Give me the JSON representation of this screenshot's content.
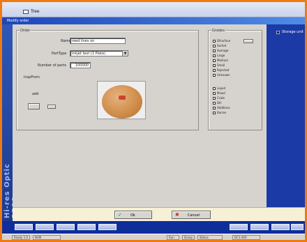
{
  "top": {
    "tab_label": "Tree"
  },
  "dialog": {
    "title": "Modify order"
  },
  "side": {
    "checkbox_label": "Storage unit"
  },
  "form": {
    "group_title": "Order",
    "name_label": "Name",
    "name_value": "reed lines on",
    "parttype_label": "PartType",
    "parttype_value": "inkjet text (1 Plate)",
    "number_label": "Number of parts",
    "number_value": "100000",
    "inspection_label": "InspFrom",
    "add_label": "add",
    "photo_label": "Ed"
  },
  "grades": {
    "group_title": "Grades",
    "set1": [
      "Dfsurface",
      "Sorted",
      "Average",
      "Large",
      "Medium",
      "Small",
      "Rejected",
      "Unknown"
    ],
    "set2": [
      "Liquid",
      "Mixed",
      "Crate",
      "DH",
      "Additions",
      "Barren"
    ]
  },
  "buttons": {
    "ok": "Ok",
    "cancel": "Cancel"
  },
  "brand": {
    "vertical_text": "Hi-res Optic 2300"
  },
  "status": {
    "cells": [
      "Ready 1.0",
      "NUM",
      "Run",
      "Dump",
      "Status",
      "DC1-400"
    ]
  },
  "colors": {
    "accent": "#1c46b8",
    "frame": "#f07a12",
    "panel": "#d6d3ce"
  }
}
